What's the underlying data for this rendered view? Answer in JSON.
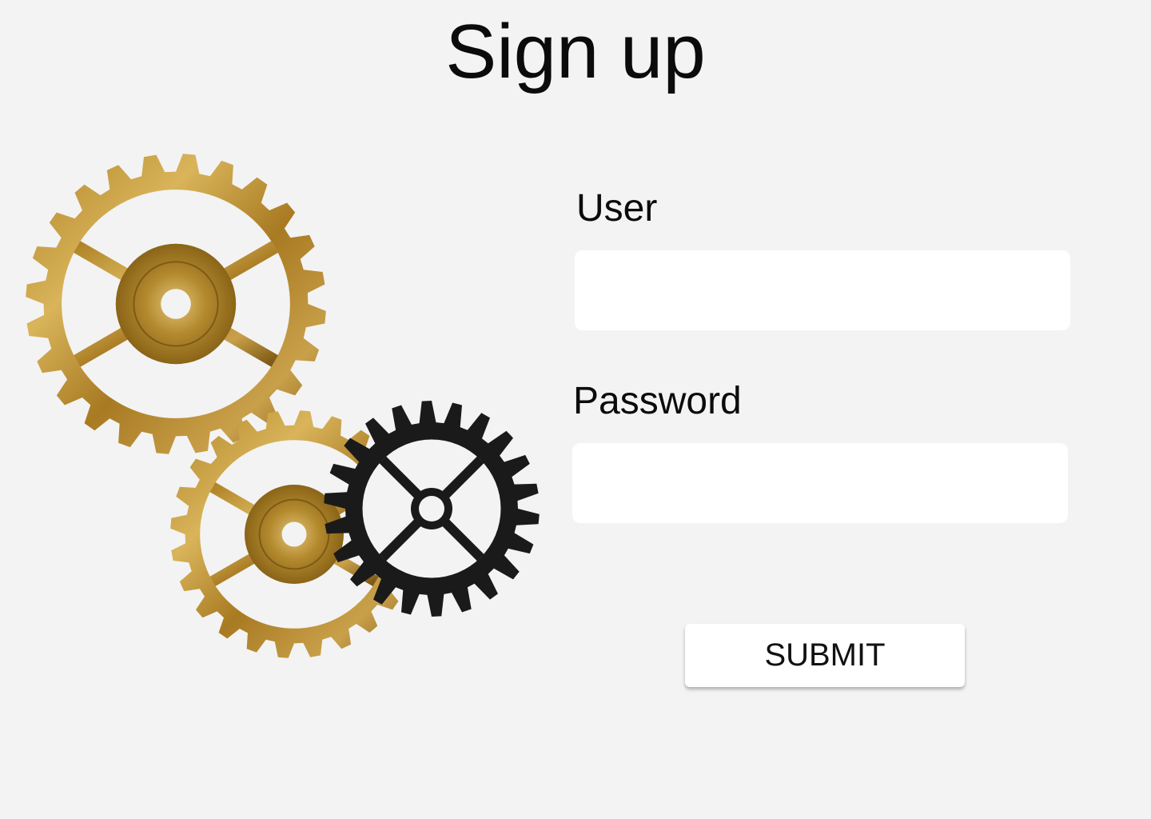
{
  "header": {
    "title": "Sign up"
  },
  "form": {
    "user_label": "User",
    "user_value": "",
    "password_label": "Password",
    "password_value": "",
    "submit_label": "SUBMIT"
  },
  "illustration": {
    "icon": "gears-illustration",
    "colors": {
      "gold": "#c29a3a",
      "gold_dark": "#8a6418",
      "black": "#1a1a1a"
    }
  },
  "colors": {
    "background": "#f3f3f3",
    "field_background": "#ffffff",
    "text": "#0b0b0b"
  }
}
